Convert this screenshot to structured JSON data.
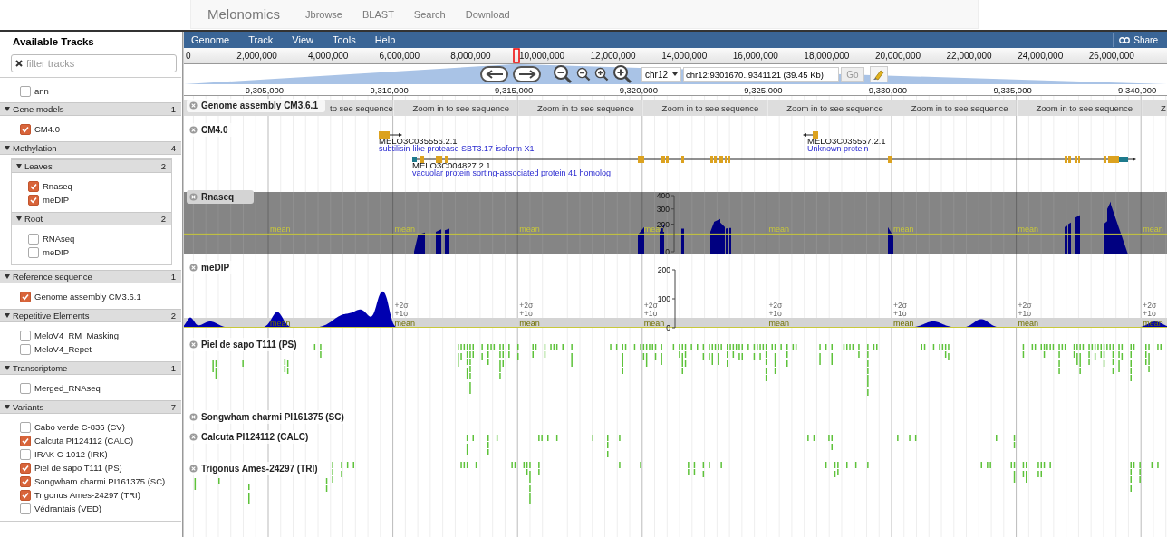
{
  "nav": {
    "brand": "Melonomics",
    "links": [
      "Jbrowse",
      "BLAST",
      "Search",
      "Download"
    ]
  },
  "sidebar": {
    "title": "Available Tracks",
    "filter": {
      "placeholder": "filter tracks"
    },
    "tracks": [
      {
        "label": "ann",
        "checked": false
      }
    ],
    "categories": [
      {
        "name": "Gene models",
        "count": "1",
        "expanded": true,
        "tracks": [
          {
            "label": "CM4.0",
            "checked": true
          }
        ]
      },
      {
        "name": "Methylation",
        "count": "4",
        "expanded": true,
        "children": [
          {
            "name": "Leaves",
            "count": "2",
            "expanded": true,
            "tracks": [
              {
                "label": "Rnaseq",
                "checked": true
              },
              {
                "label": "meDIP",
                "checked": true
              }
            ]
          },
          {
            "name": "Root",
            "count": "2",
            "expanded": true,
            "tracks": [
              {
                "label": "RNAseq",
                "checked": false
              },
              {
                "label": "meDIP",
                "checked": false
              }
            ]
          }
        ]
      },
      {
        "name": "Reference sequence",
        "count": "1",
        "expanded": true,
        "tracks": [
          {
            "label": "Genome assembly CM3.6.1",
            "checked": true
          }
        ]
      },
      {
        "name": "Repetitive Elements",
        "count": "2",
        "expanded": true,
        "tracks": [
          {
            "label": "MeloV4_RM_Masking",
            "checked": false
          },
          {
            "label": "MeloV4_Repet",
            "checked": false
          }
        ]
      },
      {
        "name": "Transcriptome",
        "count": "1",
        "expanded": true,
        "tracks": [
          {
            "label": "Merged_RNAseq",
            "checked": false
          }
        ]
      },
      {
        "name": "Variants",
        "count": "7",
        "expanded": true,
        "tracks": [
          {
            "label": "Cabo verde C-836 (CV)",
            "checked": false
          },
          {
            "label": "Calcuta PI124112 (CALC)",
            "checked": true
          },
          {
            "label": "IRAK C-1012 (IRK)",
            "checked": false
          },
          {
            "label": "Piel de sapo T111 (PS)",
            "checked": true
          },
          {
            "label": "Songwham charmi PI161375 (SC)",
            "checked": true
          },
          {
            "label": "Trigonus Ames-24297 (TRI)",
            "checked": true
          },
          {
            "label": "Védrantais (VED)",
            "checked": false
          }
        ]
      }
    ]
  },
  "menu": {
    "items": [
      "Genome",
      "Track",
      "View",
      "Tools",
      "Help"
    ],
    "share": "Share"
  },
  "overview": {
    "labels": [
      "0",
      "2,000,000",
      "4,000,000",
      "6,000,000",
      "8,000,000",
      "10,000,000",
      "12,000,000",
      "14,000,000",
      "16,000,000",
      "18,000,000",
      "20,000,000",
      "22,000,000",
      "24,000,000",
      "26,000,000"
    ]
  },
  "location": {
    "chromosome": "chr12",
    "value": "chr12:9301670..9341121 (39.45 Kb)",
    "go": "Go"
  },
  "ruler": {
    "labels": [
      "9,305,000",
      "9,310,000",
      "9,315,000",
      "9,320,000",
      "9,325,000",
      "9,330,000",
      "9,335,000",
      "9,340,000"
    ]
  },
  "tracks": [
    {
      "kind": "sequence",
      "label": "Genome assembly CM3.6.1",
      "blocks": [
        "to see sequence",
        "Zoom in to see sequence",
        "Zoom in to see sequence",
        "Zoom in to see sequence",
        "Zoom in to see sequence",
        "Zoom in to see sequence",
        "Zoom in to see sequence",
        "Z"
      ]
    },
    {
      "kind": "genes",
      "label": "CM4.0",
      "features": [
        {
          "name": "MELO3C035556.2.1",
          "description": "subtilisin-like protease SBT3.17 isoform X1"
        },
        {
          "name": "MELO3C004827.2.1",
          "description": "vacuolar protein sorting-associated protein 41 homolog"
        },
        {
          "name": "MELO3C035557.2.1",
          "description": "Unknown protein"
        }
      ]
    },
    {
      "kind": "coverage",
      "label": "Rnaseq",
      "axis": [
        "400",
        "300",
        "200",
        "0"
      ],
      "mean_labels": [
        "mean",
        "mean",
        "mean",
        "mean",
        "mean",
        "mean",
        "mean",
        "mean"
      ]
    },
    {
      "kind": "methylation",
      "label": "meDIP",
      "axis": [
        "200",
        "100",
        "0"
      ],
      "markers": [
        {
          "mean": "mean"
        },
        {
          "sd2": "+2σ",
          "sd1": "+1σ",
          "mean": "mean"
        },
        {
          "sd2": "+2σ",
          "sd1": "+1σ",
          "mean": "mean"
        },
        {
          "sd2": "+2σ",
          "sd1": "+1σ",
          "mean": "mean"
        },
        {
          "sd2": "+2σ",
          "sd1": "+1σ",
          "mean": "mean"
        },
        {
          "sd2": "+2σ",
          "sd1": "+1σ",
          "mean": "mean"
        },
        {
          "sd2": "+2σ",
          "sd1": "+1σ",
          "mean": "mean"
        },
        {
          "sd2": "+2σ",
          "sd1": "+1σ",
          "mean": "mean"
        }
      ]
    },
    {
      "kind": "variants",
      "label": "Piel de sapo T111 (PS)"
    },
    {
      "kind": "variants",
      "label": "Songwham charmi PI161375 (SC)"
    },
    {
      "kind": "variants",
      "label": "Calcuta PI124112 (CALC)"
    },
    {
      "kind": "variants",
      "label": "Trigonus Ames-24297 (TRI)"
    }
  ]
}
